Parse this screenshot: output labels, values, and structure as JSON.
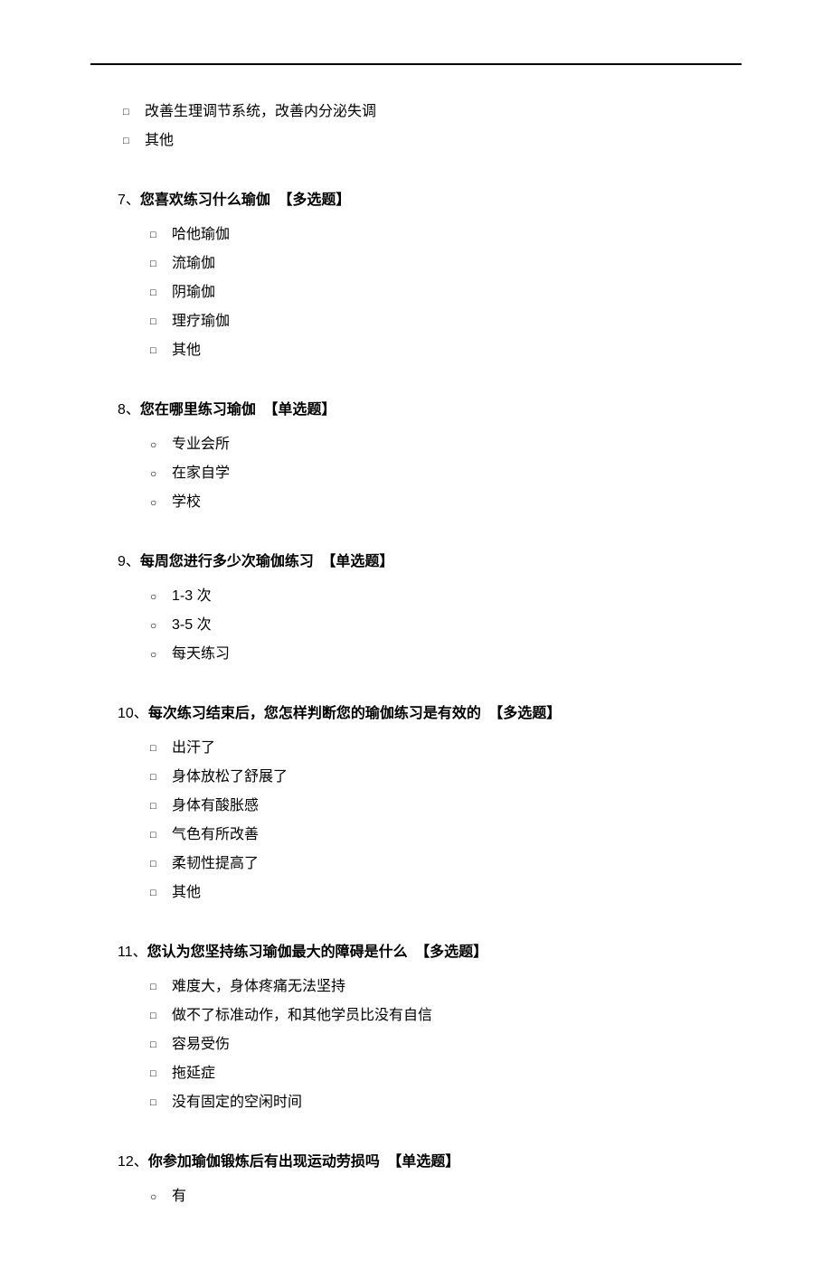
{
  "q6_trailing": {
    "options": [
      "改善生理调节系统，改善内分泌失调",
      "其他"
    ]
  },
  "questions": [
    {
      "num": "7、",
      "text": "您喜欢练习什么瑜伽",
      "tag": "【多选题】",
      "type": "checkbox",
      "options": [
        "哈他瑜伽",
        "流瑜伽",
        "阴瑜伽",
        "理疗瑜伽",
        "其他"
      ]
    },
    {
      "num": "8、",
      "text": "您在哪里练习瑜伽",
      "tag": "【单选题】",
      "type": "radio",
      "options": [
        "专业会所",
        "在家自学",
        "学校"
      ]
    },
    {
      "num": "9、",
      "text": "每周您进行多少次瑜伽练习",
      "tag": "【单选题】",
      "type": "radio",
      "options": [
        "1-3 次",
        "3-5 次",
        "每天练习"
      ]
    },
    {
      "num": "10、",
      "text": "每次练习结束后，您怎样判断您的瑜伽练习是有效的",
      "tag": "【多选题】",
      "type": "checkbox",
      "options": [
        "出汗了",
        "身体放松了舒展了",
        "身体有酸胀感",
        "气色有所改善",
        "柔韧性提高了",
        "其他"
      ]
    },
    {
      "num": "11、",
      "text": "您认为您坚持练习瑜伽最大的障碍是什么",
      "tag": "【多选题】",
      "type": "checkbox",
      "options": [
        "难度大，身体疼痛无法坚持",
        "做不了标准动作，和其他学员比没有自信",
        "容易受伤",
        "拖延症",
        "没有固定的空闲时间"
      ]
    },
    {
      "num": "12、",
      "text": "你参加瑜伽锻炼后有出现运动劳损吗",
      "tag": "【单选题】",
      "type": "radio",
      "options": [
        "有"
      ]
    }
  ]
}
